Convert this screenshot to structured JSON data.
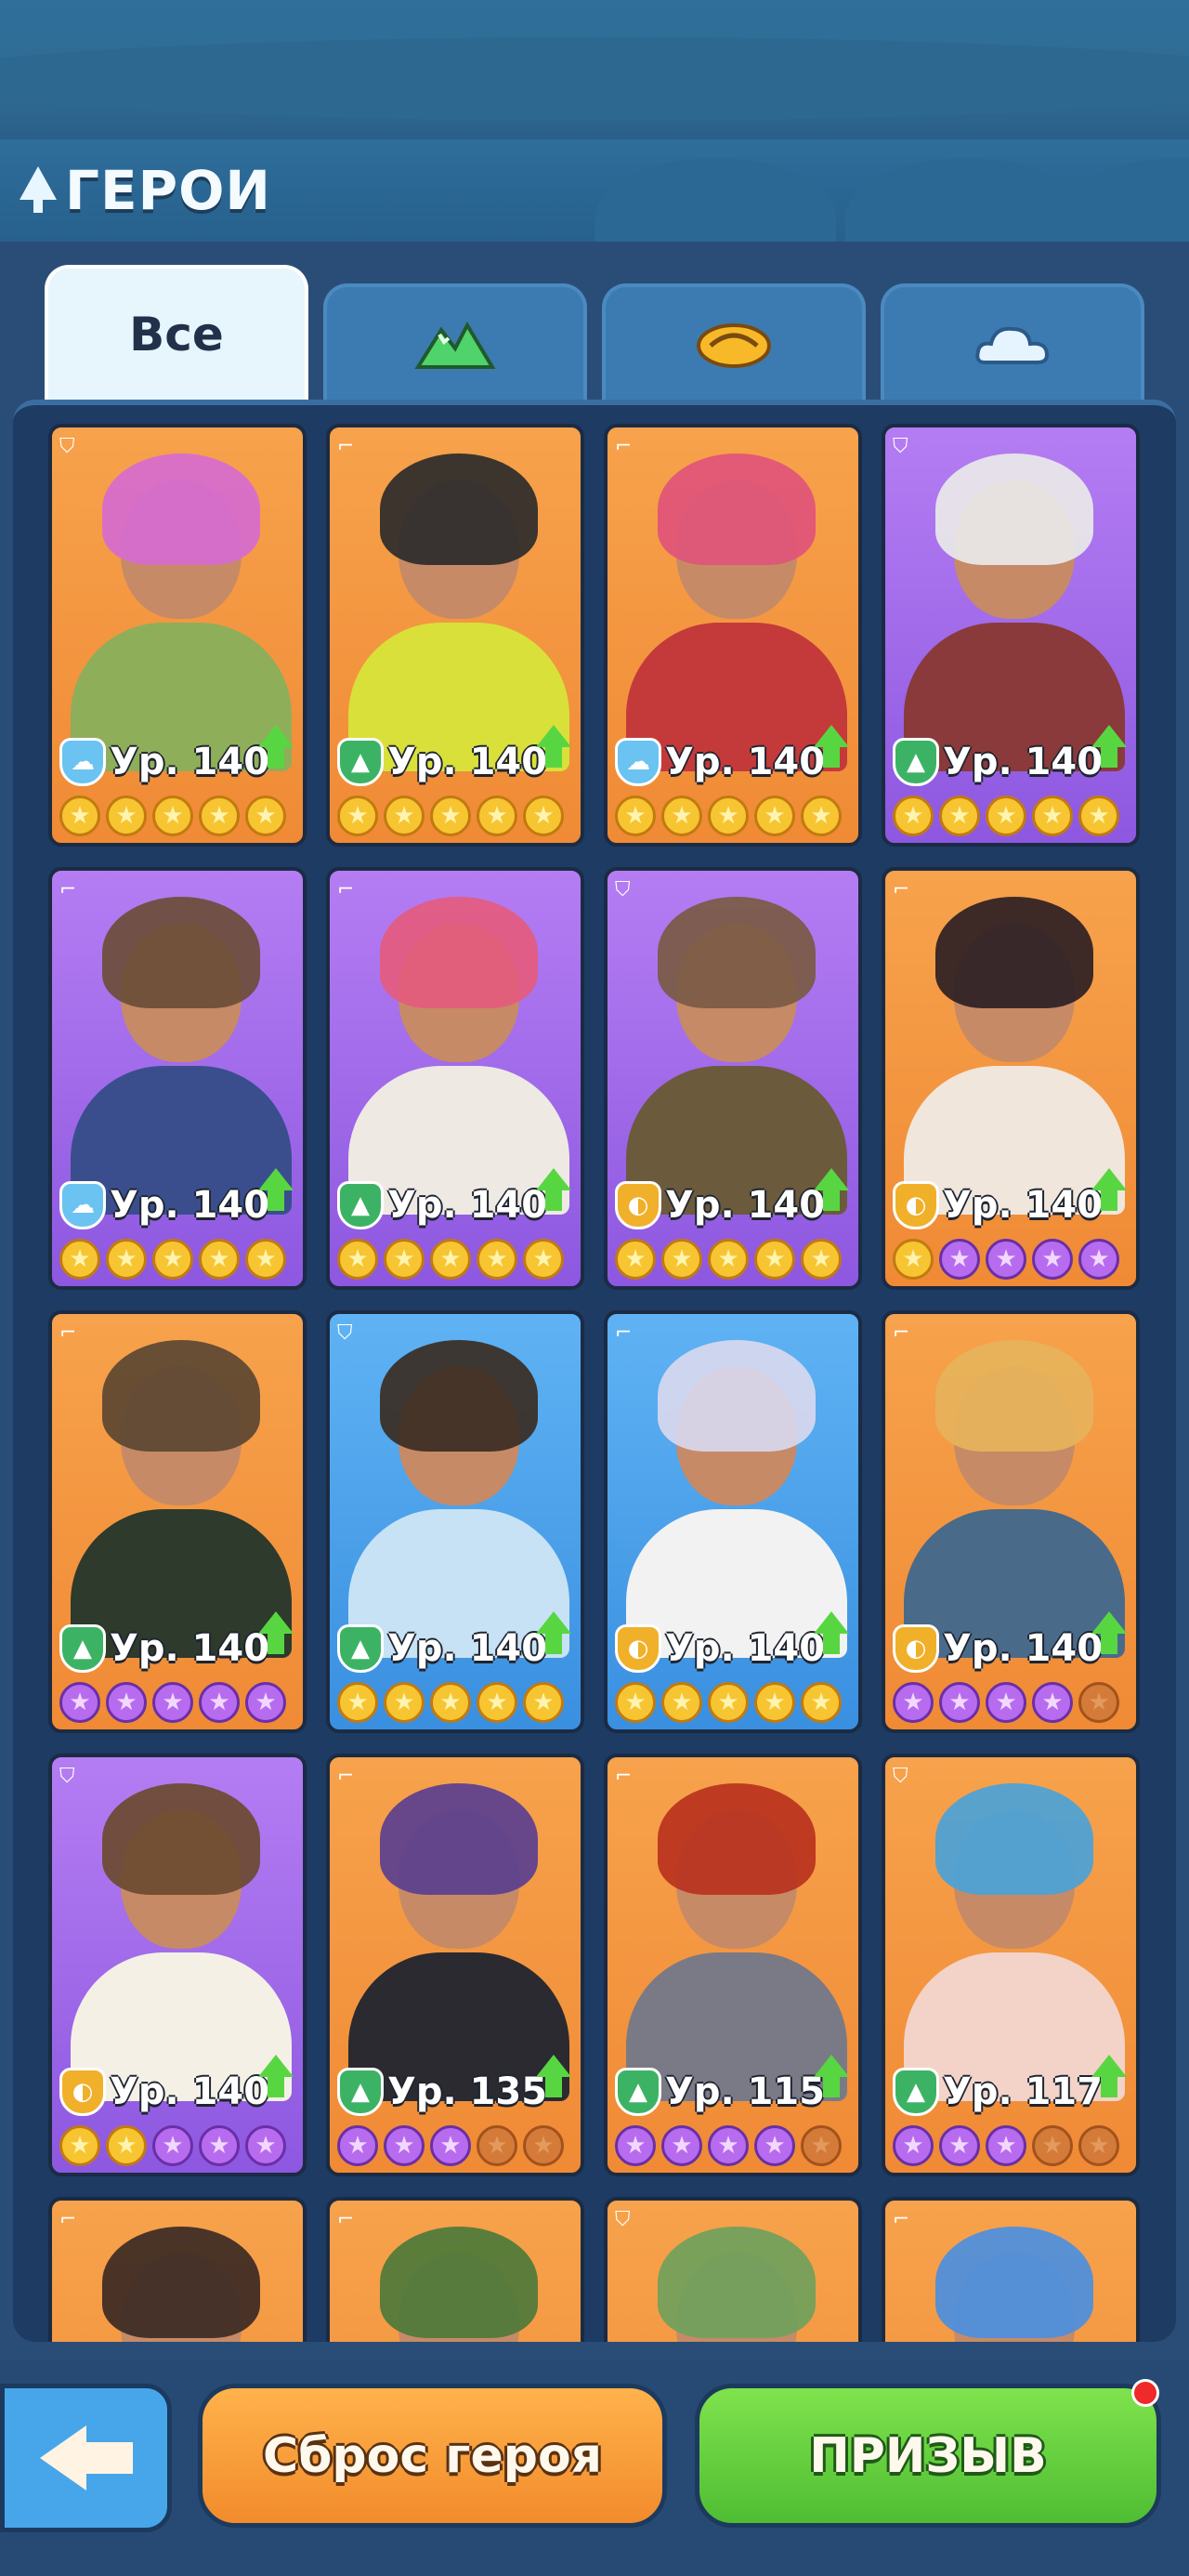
{
  "header": {
    "title": "ГЕРОИ"
  },
  "tabs": [
    {
      "label": "Все",
      "icon": "all",
      "active": true
    },
    {
      "label": "",
      "icon": "mountain-icon",
      "active": false
    },
    {
      "label": "",
      "icon": "sun-icon",
      "active": false
    },
    {
      "label": "",
      "icon": "cloud-icon",
      "active": false
    }
  ],
  "heroes": [
    {
      "level": "Ур. 140",
      "element": "cloud",
      "bg": "orange",
      "stars": [
        "g",
        "g",
        "g",
        "g",
        "g"
      ],
      "upgrade": true
    },
    {
      "level": "Ур. 140",
      "element": "mountain",
      "bg": "orange",
      "stars": [
        "g",
        "g",
        "g",
        "g",
        "g"
      ],
      "upgrade": true
    },
    {
      "level": "Ур. 140",
      "element": "cloud",
      "bg": "orange",
      "stars": [
        "g",
        "g",
        "g",
        "g",
        "g"
      ],
      "upgrade": true
    },
    {
      "level": "Ур. 140",
      "element": "mountain",
      "bg": "purple",
      "stars": [
        "g",
        "g",
        "g",
        "g",
        "g"
      ],
      "upgrade": true
    },
    {
      "level": "Ур. 140",
      "element": "cloud",
      "bg": "purple",
      "stars": [
        "g",
        "g",
        "g",
        "g",
        "g"
      ],
      "upgrade": true
    },
    {
      "level": "Ур. 140",
      "element": "mountain",
      "bg": "purple",
      "stars": [
        "g",
        "g",
        "g",
        "g",
        "g"
      ],
      "upgrade": true
    },
    {
      "level": "Ур. 140",
      "element": "sun",
      "bg": "purple",
      "stars": [
        "g",
        "g",
        "g",
        "g",
        "g"
      ],
      "upgrade": true
    },
    {
      "level": "Ур. 140",
      "element": "sun",
      "bg": "orange",
      "stars": [
        "g",
        "p",
        "p",
        "p",
        "p"
      ],
      "upgrade": true
    },
    {
      "level": "Ур. 140",
      "element": "mountain",
      "bg": "orange",
      "stars": [
        "p",
        "p",
        "p",
        "p",
        "p"
      ],
      "upgrade": true
    },
    {
      "level": "Ур. 140",
      "element": "mountain",
      "bg": "blue",
      "stars": [
        "g",
        "g",
        "g",
        "g",
        "g"
      ],
      "upgrade": true
    },
    {
      "level": "Ур. 140",
      "element": "sun",
      "bg": "blue",
      "stars": [
        "g",
        "g",
        "g",
        "g",
        "g"
      ],
      "upgrade": true
    },
    {
      "level": "Ур. 140",
      "element": "sun",
      "bg": "orange",
      "stars": [
        "p",
        "p",
        "p",
        "p",
        "e"
      ],
      "upgrade": true
    },
    {
      "level": "Ур. 140",
      "element": "sun",
      "bg": "purple",
      "stars": [
        "g",
        "g",
        "p",
        "p",
        "p"
      ],
      "upgrade": true
    },
    {
      "level": "Ур. 135",
      "element": "mountain",
      "bg": "orange",
      "stars": [
        "p",
        "p",
        "p",
        "e",
        "e"
      ],
      "upgrade": true
    },
    {
      "level": "Ур. 115",
      "element": "mountain",
      "bg": "orange",
      "stars": [
        "p",
        "p",
        "p",
        "p",
        "e"
      ],
      "upgrade": true
    },
    {
      "level": "Ур. 117",
      "element": "mountain",
      "bg": "orange",
      "stars": [
        "p",
        "p",
        "p",
        "e",
        "e"
      ],
      "upgrade": true
    },
    {
      "level": "",
      "element": "",
      "bg": "orange",
      "stars": [],
      "upgrade": false
    },
    {
      "level": "",
      "element": "",
      "bg": "orange",
      "stars": [],
      "upgrade": false
    },
    {
      "level": "",
      "element": "",
      "bg": "orange",
      "stars": [],
      "upgrade": false
    },
    {
      "level": "",
      "element": "",
      "bg": "orange",
      "stars": [],
      "upgrade": false
    }
  ],
  "buttons": {
    "reset": "Сброс героя",
    "summon": "ПРИЗЫВ"
  },
  "colors": {
    "orange": "#f7a24c",
    "purple": "#a36cef",
    "blue": "#4aa0ea",
    "gold_star": "#f7c531",
    "purple_star": "#b76cf0"
  }
}
